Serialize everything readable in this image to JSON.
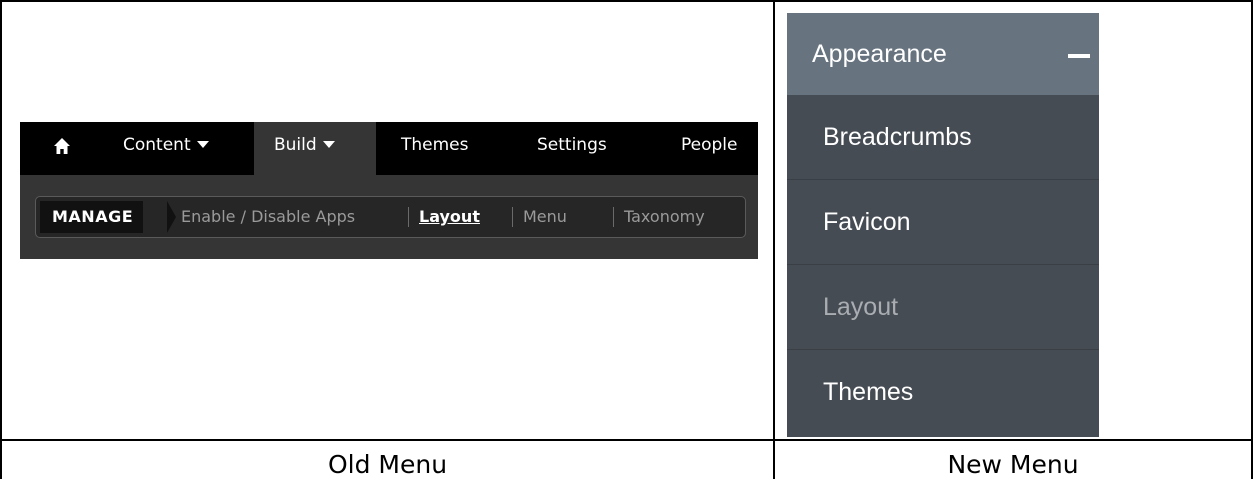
{
  "old_menu": {
    "nav": [
      {
        "label": "Content",
        "has_caret": true
      },
      {
        "label": "Build",
        "has_caret": true,
        "active": true
      },
      {
        "label": "Themes"
      },
      {
        "label": "Settings"
      },
      {
        "label": "People"
      }
    ],
    "manage_label": "MANAGE",
    "sub_items": [
      {
        "label": "Enable / Disable Apps"
      },
      {
        "label": "Layout",
        "current": true
      },
      {
        "label": "Menu"
      },
      {
        "label": "Taxonomy"
      }
    ],
    "caption": "Old Menu"
  },
  "new_menu": {
    "header": "Appearance",
    "header_icon": "minus-icon",
    "items": [
      {
        "label": "Breadcrumbs"
      },
      {
        "label": "Favicon"
      },
      {
        "label": "Layout",
        "current": true
      },
      {
        "label": "Themes"
      }
    ],
    "caption": "New Menu"
  },
  "colors": {
    "old_top_bar": "#000000",
    "old_sub_bar": "#353535",
    "new_header": "#677480",
    "new_body": "#464c54"
  }
}
